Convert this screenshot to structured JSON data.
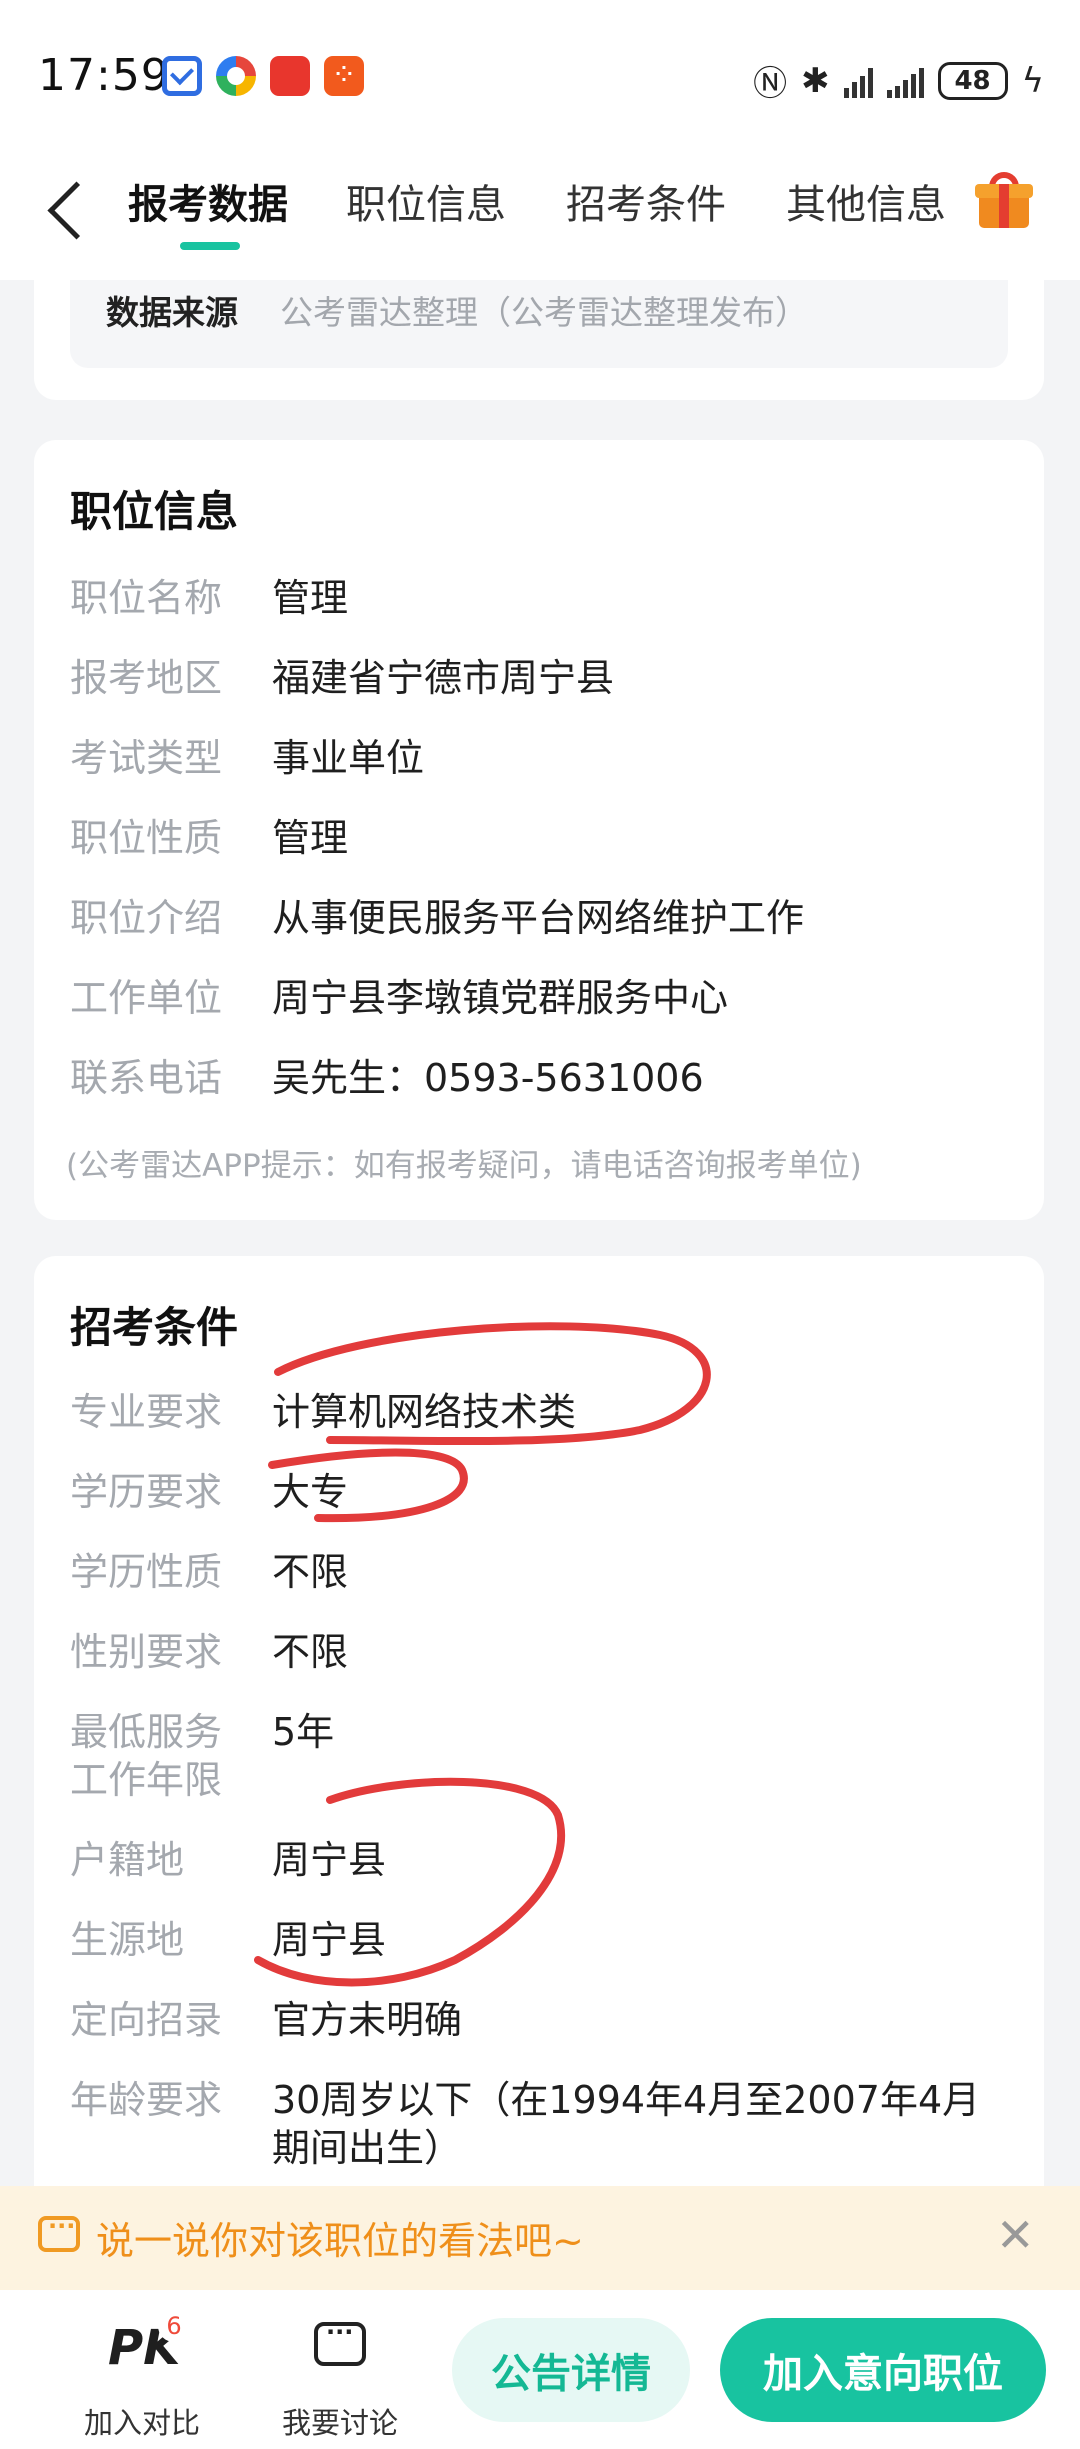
{
  "status_bar": {
    "time": "17:59",
    "battery": "48"
  },
  "nav": {
    "tabs": [
      {
        "label": "报考数据",
        "active": true
      },
      {
        "label": "职位信息",
        "active": false
      },
      {
        "label": "招考条件",
        "active": false
      },
      {
        "label": "其他信息",
        "active": false
      }
    ]
  },
  "data_source": {
    "key": "数据来源",
    "value": "公考雷达整理（公考雷达整理发布）"
  },
  "position_info": {
    "title": "职位信息",
    "rows": [
      {
        "key": "职位名称",
        "value": "管理"
      },
      {
        "key": "报考地区",
        "value": "福建省宁德市周宁县"
      },
      {
        "key": "考试类型",
        "value": "事业单位"
      },
      {
        "key": "职位性质",
        "value": "管理"
      },
      {
        "key": "职位介绍",
        "value": "从事便民服务平台网络维护工作"
      },
      {
        "key": "工作单位",
        "value": "周宁县李墩镇党群服务中心"
      },
      {
        "key": "联系电话",
        "value": "吴先生：0593-5631006"
      }
    ],
    "tip": "(公考雷达APP提示：如有报考疑问，请电话咨询报考单位)"
  },
  "requirements": {
    "title": "招考条件",
    "rows": [
      {
        "key": "专业要求",
        "value": "计算机网络技术类"
      },
      {
        "key": "学历要求",
        "value": "大专"
      },
      {
        "key": "学历性质",
        "value": "不限"
      },
      {
        "key": "性别要求",
        "value": "不限"
      },
      {
        "key": "最低服务工作年限",
        "value": "5年"
      },
      {
        "key": "户籍地",
        "value": "周宁县"
      },
      {
        "key": "生源地",
        "value": "周宁县"
      },
      {
        "key": "定向招录",
        "value": "官方未明确"
      },
      {
        "key": "年龄要求",
        "value": "30周岁以下（在1994年4月至2007年4月期间出生）"
      }
    ]
  },
  "banner": {
    "text": "说一说你对该职位的看法吧~"
  },
  "bottom_bar": {
    "pk_label": "PK",
    "pk_count": "6",
    "compare_label": "加入对比",
    "discuss_label": "我要讨论",
    "notice_button": "公告详情",
    "add_button": "加入意向职位"
  },
  "colors": {
    "accent": "#18c3a0",
    "banner_text": "#ef8f1a",
    "annotation": "#e23b3b"
  }
}
